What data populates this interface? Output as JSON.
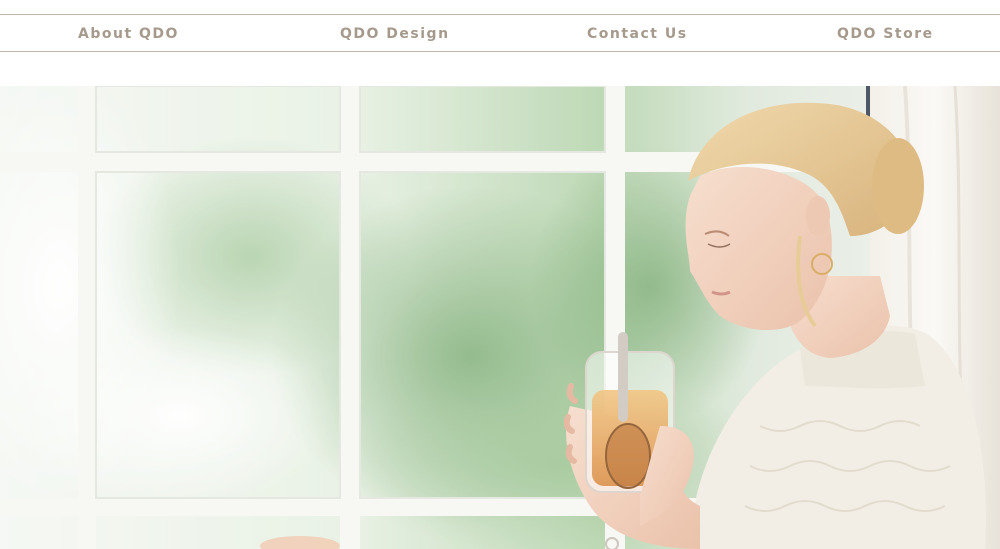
{
  "nav": {
    "items": [
      {
        "label": "About QDO"
      },
      {
        "label": "QDO Design"
      },
      {
        "label": "Contact Us"
      },
      {
        "label": "QDO Store"
      }
    ]
  },
  "hero": {
    "image_alt": "Woman by a window holding a glass mug of tea with a tea infuser",
    "colors": {
      "foliage": "#8fbf8a",
      "window_frame": "#f6f6f2",
      "hair": "#e2c287",
      "sweater": "#f0ece2",
      "tea": "#e3a55a"
    }
  }
}
